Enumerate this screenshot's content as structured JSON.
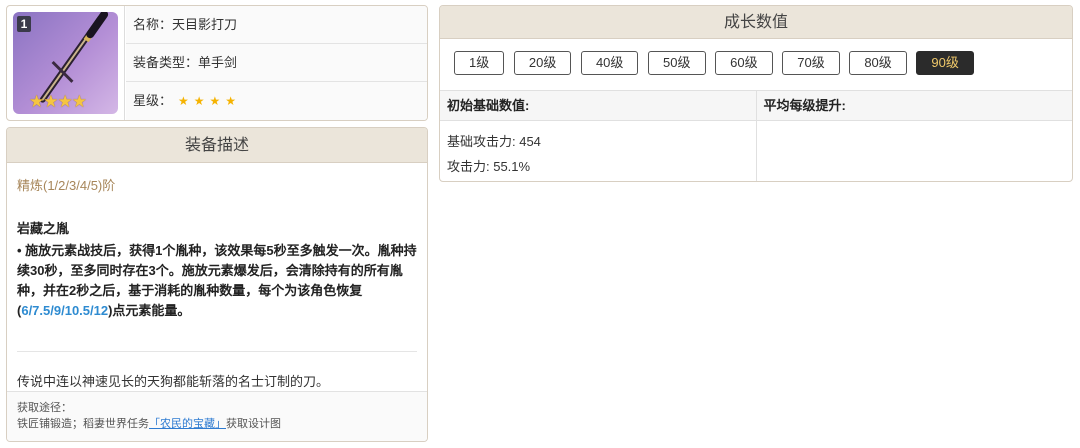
{
  "info": {
    "rarity_badge": "1",
    "name_label": "名称：天目影打刀",
    "type_label": "装备类型：单手剑",
    "star_label": "星级：",
    "stars_big": "★★★★",
    "stars_small": "★★★★",
    "rarity": 4
  },
  "desc": {
    "title": "装备描述",
    "refine": "精炼(1/2/3/4/5)阶",
    "skill_name": "岩藏之胤",
    "skill_text_1": "• 施放元素战技后，获得1个胤种，该效果每5秒至多触发一次。胤种持续30秒，至多同时存在3个。施放元素爆发后，会清除持有的所有胤种，并在2秒之后，基于消耗的胤种数量，每个为该角色恢复(",
    "skill_values": "6/7.5/9/10.5/12",
    "skill_text_2": ")点元素能量。",
    "lore": "传说中连以神速见长的天狗都能斩落的名士订制的刀。",
    "source_label": "获取途径：",
    "source_prefix": "铁匠铺锻造；稻妻世界任务",
    "source_link": "「农民的宝藏」",
    "source_suffix": "获取设计图"
  },
  "growth": {
    "title": "成长数值",
    "levels": [
      "1级",
      "20级",
      "40级",
      "50级",
      "60级",
      "70级",
      "80级",
      "90级"
    ],
    "active_level": "90级",
    "col1_header": "初始基础数值:",
    "col2_header": "平均每级提升:",
    "stat_atk": "基础攻击力: 454",
    "stat_atk_pct": "攻击力: 55.1%"
  },
  "colors": {
    "accent_gold": "#f0c96a",
    "link_blue": "#2e7bd1",
    "highlight_blue": "#2e8bd1",
    "refine_brown": "#a7865a",
    "header_bg": "#ebe5da"
  }
}
